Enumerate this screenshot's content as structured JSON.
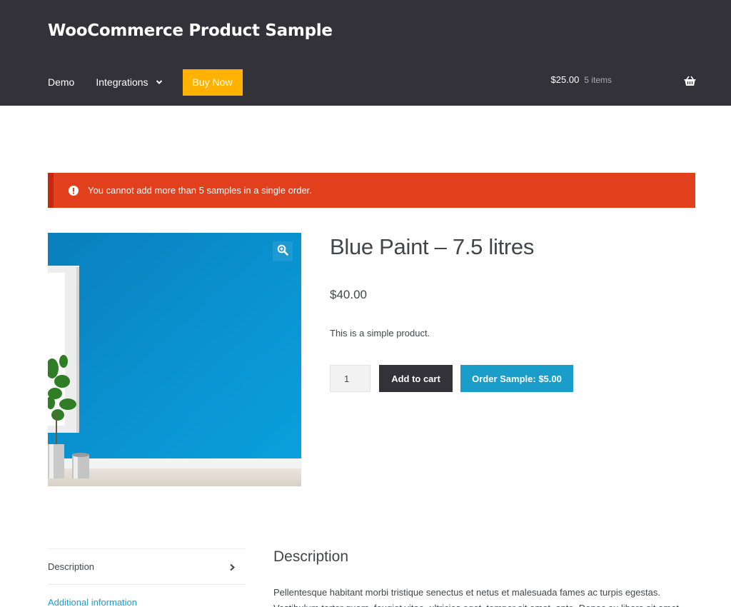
{
  "site": {
    "title": "WooCommerce Product Sample"
  },
  "nav": {
    "items": [
      {
        "label": "Demo"
      },
      {
        "label": "Integrations"
      }
    ],
    "buy_now": "Buy Now"
  },
  "cart": {
    "amount": "$25.00",
    "count": "5 items"
  },
  "notice": {
    "message": "You cannot add more than 5 samples in a single order.",
    "color": "#e2401c"
  },
  "product": {
    "title": "Blue Paint – 7.5 litres",
    "price": "$40.00",
    "short_description": "This is a simple product.",
    "quantity": "1",
    "add_to_cart_label": "Add to cart",
    "order_sample_label": "Order Sample: $5.00",
    "image_icon": "zoom-in-icon"
  },
  "tabs": [
    {
      "label": "Description"
    },
    {
      "label": "Additional information"
    }
  ],
  "description": {
    "heading": "Description",
    "body": "Pellentesque habitant morbi tristique senectus et netus et malesuada fames ac turpis egestas. Vestibulum tortor quam, feugiat vitae, ultricies eget, tempor sit amet, ante. Donec eu libero sit amet"
  },
  "colors": {
    "header": "#333238",
    "buy_now": "#ffb200",
    "accent": "#1a9ec9",
    "notice": "#e2401c"
  }
}
